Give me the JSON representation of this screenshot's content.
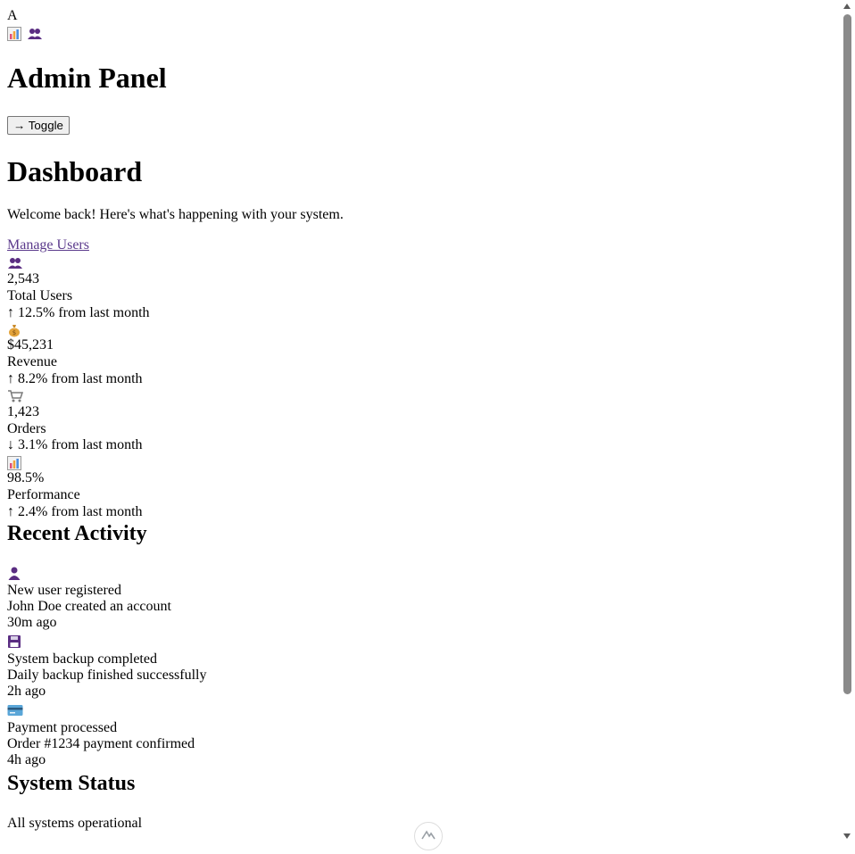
{
  "brand": {
    "letter": "A"
  },
  "nav": {
    "icons": [
      "chart-icon",
      "users-icon"
    ]
  },
  "admin": {
    "title": "Admin Panel",
    "toggle_label": "→ Toggle"
  },
  "dashboard": {
    "title": "Dashboard",
    "welcome": "Welcome back! Here's what's happening with your system.",
    "manage_users": "Manage Users"
  },
  "stats": [
    {
      "icon": "users-icon",
      "value": "2,543",
      "label": "Total Users",
      "change": "↑ 12.5% from last month"
    },
    {
      "icon": "money-bag-icon",
      "value": "$45,231",
      "label": "Revenue",
      "change": "↑ 8.2% from last month"
    },
    {
      "icon": "cart-icon",
      "value": "1,423",
      "label": "Orders",
      "change": "↓ 3.1% from last month"
    },
    {
      "icon": "chart-icon",
      "value": "98.5%",
      "label": "Performance",
      "change": "↑ 2.4% from last month"
    }
  ],
  "recent": {
    "title": "Recent Activity",
    "items": [
      {
        "icon": "user-icon",
        "title": "New user registered",
        "desc": "John Doe created an account",
        "time": "30m ago"
      },
      {
        "icon": "floppy-disk-icon",
        "title": "System backup completed",
        "desc": "Daily backup finished successfully",
        "time": "2h ago"
      },
      {
        "icon": "credit-card-icon",
        "title": "Payment processed",
        "desc": "Order #1234 payment confirmed",
        "time": "4h ago"
      }
    ]
  },
  "status": {
    "title": "System Status",
    "text": "All systems operational"
  },
  "colors": {
    "link": "#5b3a8c",
    "accent": "#5a2d82"
  }
}
